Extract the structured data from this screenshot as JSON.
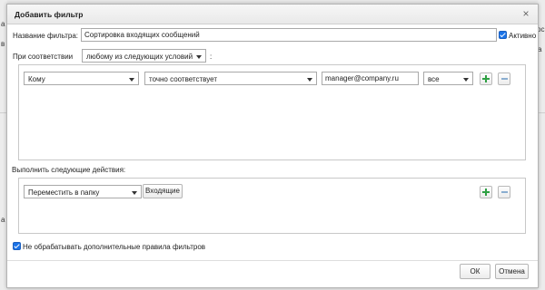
{
  "background": {
    "snippet_1": "а",
    "snippet_2": "в",
    "snippet_3": "а",
    "snippet_4": "ос",
    "snippet_5": "а"
  },
  "dialog": {
    "title": "Добавить фильтр",
    "close_icon": "×",
    "filter_name_label": "Название фильтра:",
    "filter_name_value": "Сортировка входящих сообщений",
    "active_label": "Активно",
    "active_checked": true,
    "match_label": "При соответствии",
    "match_mode": "любому из следующих условий",
    "match_colon": ":",
    "condition": {
      "field": "Кому",
      "operator": "точно соответствует",
      "value": "manager@company.ru",
      "scope": "все"
    },
    "actions_label": "Выполнить следующие действия:",
    "action": {
      "type": "Переместить в папку",
      "folder": "Входящие"
    },
    "stop_rules_label": "Не обрабатывать дополнительные правила фильтров",
    "stop_rules_checked": true,
    "ok_label": "ОК",
    "cancel_label": "Отмена"
  },
  "colors": {
    "checkbox": "#1a73e8",
    "plus": "#2ea043",
    "minus": "#8aaed0"
  }
}
